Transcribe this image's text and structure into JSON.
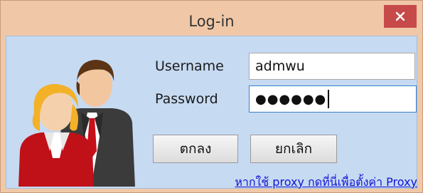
{
  "window": {
    "title": "Log-in"
  },
  "form": {
    "username_label": "Username",
    "username_value": "admwu",
    "password_label": "Password",
    "password_masked": "●●●●●●"
  },
  "buttons": {
    "ok_label": "ตกลง",
    "cancel_label": "ยกเลิก"
  },
  "proxy_link": "หากใช้ proxy กดที่นี่เพื่อตั้งค่า Proxy",
  "icons": {
    "close": "close-icon",
    "avatar": "users-avatar-icon"
  },
  "colors": {
    "titlebar": "#f0c8a8",
    "client_bg": "#c6daf2",
    "close_button": "#c74a4a",
    "link": "#1212d6"
  }
}
